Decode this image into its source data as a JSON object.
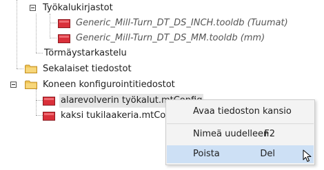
{
  "tree": {
    "items": [
      {
        "label": "Työkalukirjastot"
      },
      {
        "label": "Generic_Mill-Turn_DT_DS_INCH.tooldb (Tuumat)"
      },
      {
        "label": "Generic_Mill-Turn_DT_DS_MM.tooldb (mm)"
      },
      {
        "label": "Törmäystarkastelu"
      },
      {
        "label": "Sekalaiset tiedostot"
      },
      {
        "label": "Koneen konfigurointitiedostot"
      },
      {
        "label": "alarevolverin työkalut.mtConfig"
      },
      {
        "label": "kaksi tukilaakeria.mtConfig"
      }
    ]
  },
  "context_menu": {
    "items": [
      {
        "label": "Avaa tiedoston kansio",
        "shortcut": ""
      },
      {
        "label": "Nimeä uudelleen",
        "shortcut": "F2"
      },
      {
        "label": "Poista",
        "shortcut": "Del"
      }
    ]
  },
  "colors": {
    "folder": "#e8b84a",
    "red_file": "#d9303a",
    "menu_highlight": "#cde0f5"
  }
}
